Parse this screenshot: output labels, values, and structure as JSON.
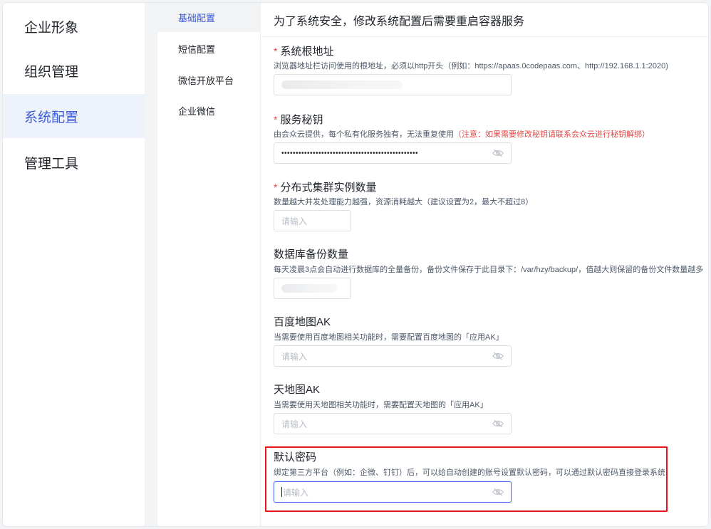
{
  "sidebar": {
    "items": [
      {
        "label": "企业形象",
        "active": false
      },
      {
        "label": "组织管理",
        "active": false
      },
      {
        "label": "系统配置",
        "active": true
      },
      {
        "label": "管理工具",
        "active": false
      }
    ]
  },
  "subnav": {
    "items": [
      {
        "label": "基础配置",
        "active": true
      },
      {
        "label": "短信配置",
        "active": false
      },
      {
        "label": "微信开放平台",
        "active": false
      },
      {
        "label": "企业微信",
        "active": false
      }
    ]
  },
  "main": {
    "notice": "为了系统安全，修改系统配置后需要重启容器服务",
    "fields": {
      "root_url": {
        "required_mark": "*",
        "label": "系统根地址",
        "desc": "浏览器地址栏访问使用的根地址，必须以http开头（例如：https://apaas.0codepaas.com、http://192.168.1.1:2020)"
      },
      "service_key": {
        "required_mark": "*",
        "label": "服务秘钥",
        "desc": "由会众云提供，每个私有化服务独有，无法重复使用",
        "warning": "（注意：如果需要修改秘钥请联系会众云进行秘钥解绑）",
        "value_masked": "••••••••••••••••••••••••••••••••••••••••••••••••"
      },
      "cluster_count": {
        "required_mark": "*",
        "label": "分布式集群实例数量",
        "desc": "数量越大并发处理能力越强，资源消耗越大（建议设置为2，最大不超过8）",
        "placeholder": "请输入"
      },
      "db_backup": {
        "label": "数据库备份数量",
        "desc": "每天凌晨3点会自动进行数据库的全量备份，备份文件保存于此目录下：/var/hzy/backup/，值越大则保留的备份文件数量越多"
      },
      "baidu_ak": {
        "label": "百度地图AK",
        "desc": "当需要使用百度地图相关功能时，需要配置百度地图的「应用AK」",
        "placeholder": "请输入"
      },
      "tianditu_ak": {
        "label": "天地图AK",
        "desc": "当需要使用天地图相关功能时，需要配置天地图的「应用AK」",
        "placeholder": "请输入"
      },
      "default_password": {
        "label": "默认密码",
        "desc": "绑定第三方平台（例如：企微、钉钉）后，可以给自动创建的账号设置默认密码，可以通过默认密码直接登录系统",
        "placeholder": "请输入"
      }
    }
  },
  "colors": {
    "accent": "#3b5bdb",
    "required": "#e54545",
    "highlight_box": "#e8161b"
  }
}
